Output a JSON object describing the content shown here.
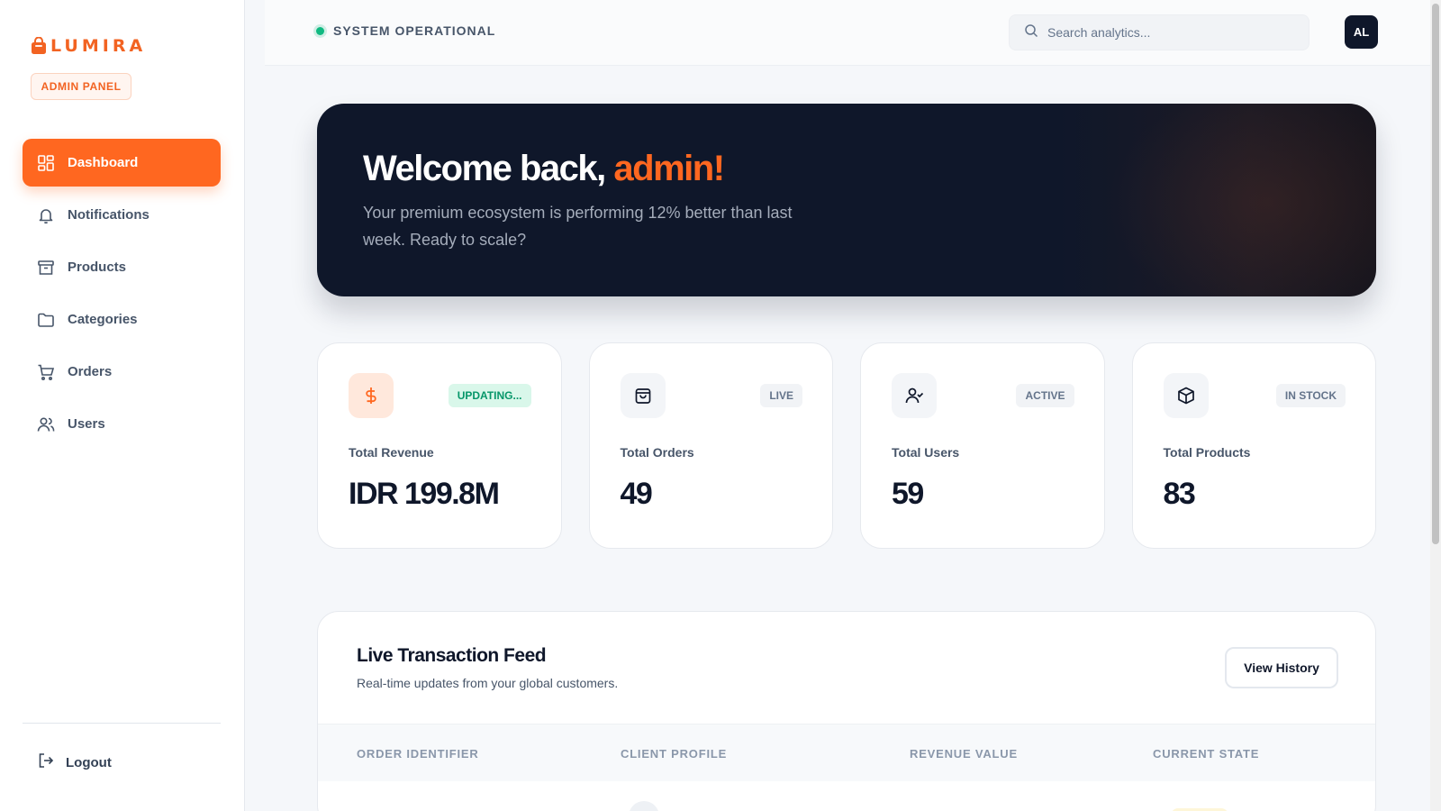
{
  "brand": {
    "name": "LUMIRA",
    "badge": "ADMIN PANEL"
  },
  "sidebar": {
    "items": [
      {
        "label": "Dashboard",
        "icon": "dashboard-icon",
        "active": true
      },
      {
        "label": "Notifications",
        "icon": "bell-icon",
        "active": false
      },
      {
        "label": "Products",
        "icon": "archive-icon",
        "active": false
      },
      {
        "label": "Categories",
        "icon": "folder-icon",
        "active": false
      },
      {
        "label": "Orders",
        "icon": "cart-icon",
        "active": false
      },
      {
        "label": "Users",
        "icon": "users-icon",
        "active": false
      }
    ],
    "logout_label": "Logout"
  },
  "header": {
    "status_text": "SYSTEM OPERATIONAL",
    "search_placeholder": "Search analytics...",
    "avatar_initials": "AL"
  },
  "hero": {
    "title_prefix": "Welcome back,",
    "title_accent": "admin!",
    "subtitle": "Your premium ecosystem is performing 12% better than last week. Ready to scale?"
  },
  "stats": [
    {
      "label": "Total Revenue",
      "value": "IDR 199.8M",
      "badge": "UPDATING...",
      "icon": "dollar-icon"
    },
    {
      "label": "Total Orders",
      "value": "49",
      "badge": "LIVE",
      "icon": "shopping-bag-icon"
    },
    {
      "label": "Total Users",
      "value": "59",
      "badge": "ACTIVE",
      "icon": "user-check-icon"
    },
    {
      "label": "Total Products",
      "value": "83",
      "badge": "IN STOCK",
      "icon": "box-icon"
    }
  ],
  "feed": {
    "title": "Live Transaction Feed",
    "subtitle": "Real-time updates from your global customers.",
    "button_label": "View History",
    "columns": [
      "ORDER IDENTIFIER",
      "CLIENT PROFILE",
      "REVENUE VALUE",
      "CURRENT STATE"
    ]
  },
  "colors": {
    "accent": "#ff6720",
    "dark": "#0f172a",
    "success": "#10b981"
  }
}
